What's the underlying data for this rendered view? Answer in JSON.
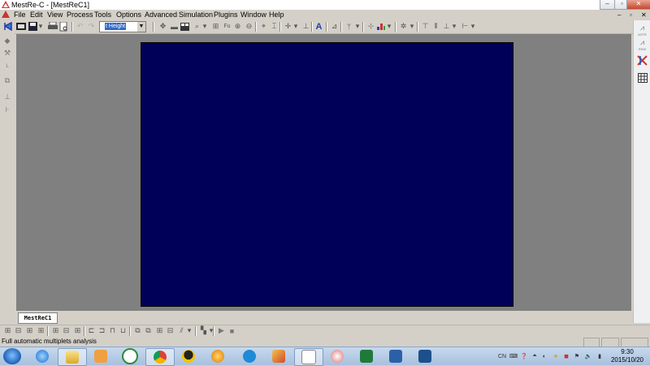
{
  "window": {
    "title": "MestRe-C - [MestReC1]",
    "controls": {
      "minimize": "–",
      "restore": "▫",
      "close": "✕"
    }
  },
  "menubar": {
    "items": [
      "File",
      "Edit",
      "View",
      "Process",
      "Tools",
      "Options",
      "Advanced",
      "Simulation",
      "Plugins",
      "Window",
      "Help"
    ],
    "mdi_controls": {
      "minimize": "–",
      "restore": "▫",
      "close": "✕"
    }
  },
  "toolbar": {
    "height_combo": {
      "value": "t Height"
    }
  },
  "rightbar": {
    "labels": [
      "ASTR",
      "RKW"
    ]
  },
  "document_tab": {
    "label": "MestReC1"
  },
  "statusbar": {
    "text": "Full automatic multiplets analysis"
  },
  "taskbar": {
    "tray": {
      "lang": "CN"
    },
    "clock": {
      "time": "9:30",
      "date": "2015/10/20"
    }
  },
  "colors": {
    "spectrum_background": "#000058",
    "workspace": "#808080",
    "chrome": "#d4d0c8"
  }
}
